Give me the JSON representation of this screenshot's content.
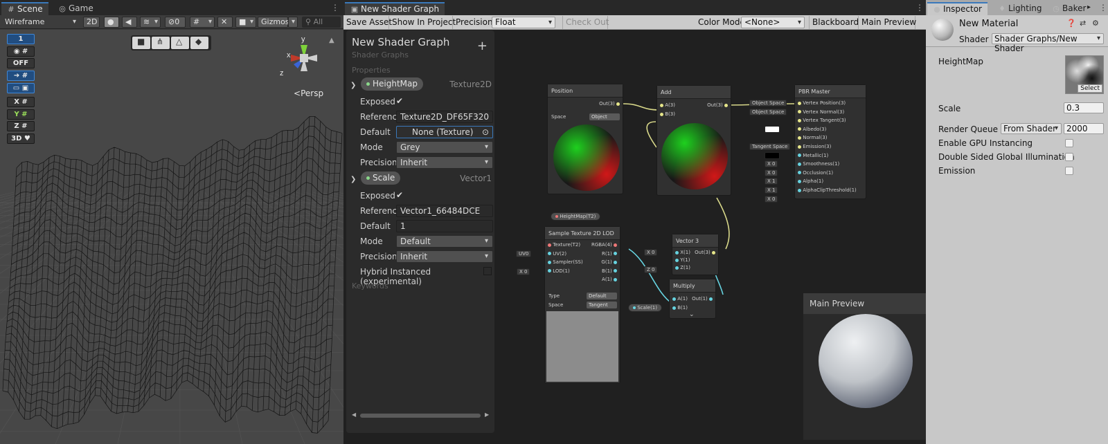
{
  "scene": {
    "tabs": [
      {
        "label": "Scene",
        "icon": "grid-icon"
      },
      {
        "label": "Game",
        "icon": "gamepad-icon"
      }
    ],
    "shading_mode": "Wireframe",
    "mode_2d": "2D",
    "hidden_count": "0",
    "gizmos_label": "Gizmos",
    "search_placeholder": "All",
    "side_buttons": [
      "1",
      "OFF",
      "X",
      "Y",
      "Z",
      "3D"
    ],
    "axis_labels": {
      "y": "y",
      "x": "x",
      "z": "z"
    },
    "projection": "Persp"
  },
  "graph": {
    "tab_label": "New Shader Graph",
    "toolbar": {
      "save_asset": "Save Asset",
      "show_in_project": "Show In Project",
      "precision_label": "Precision",
      "precision_value": "Float",
      "check_out": "Check Out",
      "color_mode_label": "Color Mode",
      "color_mode_value": "<None>",
      "blackboard": "Blackboard",
      "main_preview": "Main Preview"
    },
    "blackboard": {
      "title": "New Shader Graph",
      "subtitle": "Shader Graphs",
      "properties_label": "Properties",
      "keywords_label": "Keywords",
      "heightmap": {
        "name": "HeightMap",
        "type": "Texture2D",
        "exposed_label": "Exposed",
        "reference_label": "Reference",
        "reference": "Texture2D_DF65F320",
        "default_label": "Default",
        "default": "None (Texture)",
        "mode_label": "Mode",
        "mode": "Grey",
        "precision_label": "Precision",
        "precision": "Inherit"
      },
      "scale": {
        "name": "Scale",
        "type": "Vector1",
        "exposed_label": "Exposed",
        "reference_label": "Reference",
        "reference": "Vector1_66484DCE",
        "default_label": "Default",
        "default": "1",
        "mode_label": "Mode",
        "mode": "Default",
        "precision_label": "Precision",
        "precision": "Inherit",
        "hybrid_label": "Hybrid Instanced (experimental)"
      }
    },
    "nodes": {
      "position": {
        "title": "Position",
        "out": "Out(3)",
        "space_label": "Space",
        "space": "Object"
      },
      "add": {
        "title": "Add",
        "in_a": "A(3)",
        "in_b": "B(3)",
        "out": "Out(3)"
      },
      "pbr": {
        "title": "PBR Master",
        "ports": [
          "Vertex Position(3)",
          "Vertex Normal(3)",
          "Vertex Tangent(3)",
          "Albedo(3)",
          "Normal(3)",
          "Emission(3)",
          "Metallic(1)",
          "Smoothness(1)",
          "Occlusion(1)",
          "Alpha(1)",
          "AlphaClipThreshold(1)"
        ],
        "tags": [
          "Object Space",
          "Object Space",
          "",
          "Tangent Space",
          "",
          "X 0",
          "X 0",
          "X 1",
          "X 1",
          "X 0"
        ]
      },
      "heightmap_prop": "HeightMap(T2)",
      "sample": {
        "title": "Sample Texture 2D LOD",
        "inputs": [
          "Texture(T2)",
          "UV(2)",
          "Sampler(SS)",
          "LOD(1)"
        ],
        "outputs": [
          "RGBA(4)",
          "R(1)",
          "G(1)",
          "B(1)",
          "A(1)"
        ],
        "uv_tag": "UV0",
        "lod_tag": "X 0",
        "type_label": "Type",
        "type": "Default",
        "space_label": "Space",
        "space": "Tangent"
      },
      "vector3": {
        "title": "Vector 3",
        "inputs": [
          "X(1)",
          "Y(1)",
          "Z(1)"
        ],
        "out": "Out(3)",
        "x_tag": "X 0",
        "z_tag": "Z 0"
      },
      "multiply": {
        "title": "Multiply",
        "in_a": "A(1)",
        "in_b": "B(1)",
        "out": "Out(1)"
      },
      "scale_prop": "Scale(1)"
    },
    "main_preview_title": "Main Preview"
  },
  "inspector": {
    "tabs": [
      {
        "label": "Inspector",
        "icon": "info-icon"
      },
      {
        "label": "Lighting",
        "icon": "bulb-icon"
      },
      {
        "label": "Baker",
        "icon": "clock-icon"
      }
    ],
    "material_name": "New Material",
    "shader_label": "Shader",
    "shader_value": "Shader Graphs/New Shader",
    "heightmap_label": "HeightMap",
    "select_label": "Select",
    "scale_label": "Scale",
    "scale_value": "0.3",
    "render_queue_label": "Render Queue",
    "render_queue_mode": "From Shader",
    "render_queue_value": "2000",
    "gpu_instancing_label": "Enable GPU Instancing",
    "double_sided_gi_label": "Double Sided Global Illumination",
    "emission_label": "Emission"
  }
}
